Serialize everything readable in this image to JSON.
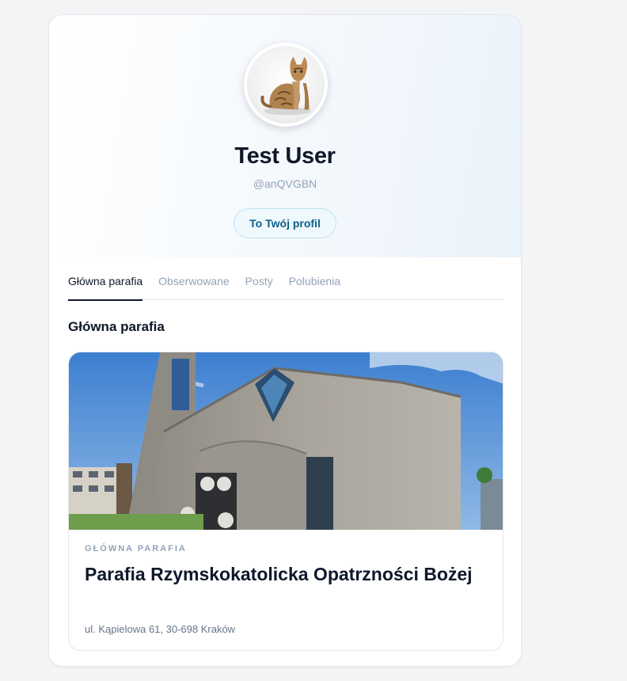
{
  "profile": {
    "name": "Test User",
    "handle": "@anQVGBN",
    "own_profile_badge": "To Twój profil",
    "avatar_icon": "cat-avatar-icon"
  },
  "tabs": [
    {
      "label": "Główna parafia",
      "active": true
    },
    {
      "label": "Obserwowane",
      "active": false
    },
    {
      "label": "Posty",
      "active": false
    },
    {
      "label": "Polubienia",
      "active": false
    }
  ],
  "section": {
    "title": "Główna parafia"
  },
  "parish": {
    "label": "GŁÓWNA PARAFIA",
    "name": "Parafia Rzymskokatolicka Opatrzności Bożej",
    "address": "ul. Kąpielowa 61, 30-698 Kraków",
    "photo_icon": "church-photo"
  },
  "colors": {
    "accent_text": "#0f5f86",
    "accent_bg": "#eef8fd",
    "text_primary": "#0f172a",
    "text_muted": "#94a3b8"
  }
}
